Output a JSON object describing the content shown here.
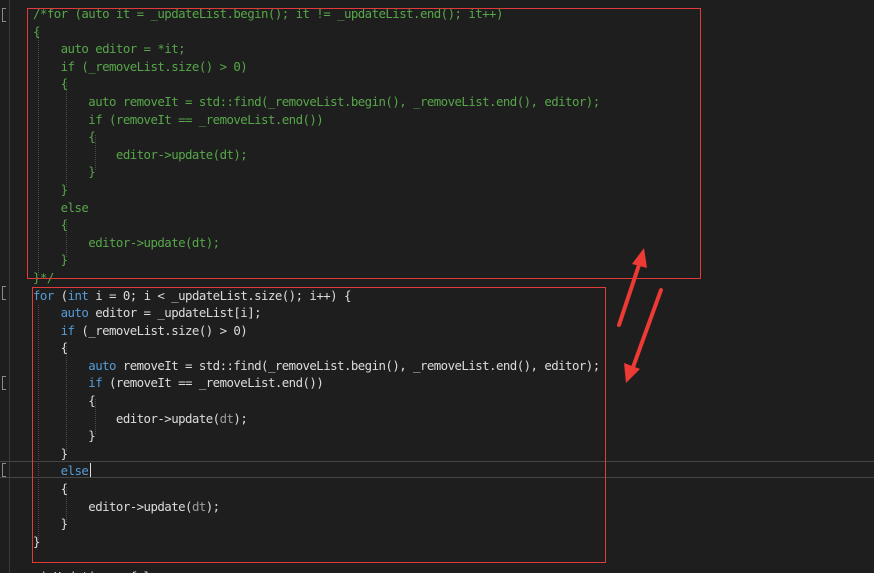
{
  "editor": {
    "lines": [
      {
        "indent": "",
        "tokens": [
          {
            "t": "/*for (auto it = _updateList.begin(); it != _updateList.end(); it++)",
            "c": "c"
          }
        ]
      },
      {
        "indent": "",
        "tokens": [
          {
            "t": "{",
            "c": "c"
          }
        ]
      },
      {
        "indent": "    ",
        "tokens": [
          {
            "t": "auto editor = *it;",
            "c": "c"
          }
        ]
      },
      {
        "indent": "    ",
        "tokens": [
          {
            "t": "if (_removeList.size() > 0)",
            "c": "c"
          }
        ]
      },
      {
        "indent": "    ",
        "tokens": [
          {
            "t": "{",
            "c": "c"
          }
        ]
      },
      {
        "indent": "        ",
        "tokens": [
          {
            "t": "auto removeIt = std::find(_removeList.begin(), _removeList.end(), editor);",
            "c": "c"
          }
        ]
      },
      {
        "indent": "        ",
        "tokens": [
          {
            "t": "if (removeIt == _removeList.end())",
            "c": "c"
          }
        ]
      },
      {
        "indent": "        ",
        "tokens": [
          {
            "t": "{",
            "c": "c"
          }
        ]
      },
      {
        "indent": "            ",
        "tokens": [
          {
            "t": "editor->update(dt);",
            "c": "c"
          }
        ]
      },
      {
        "indent": "        ",
        "tokens": [
          {
            "t": "}",
            "c": "c"
          }
        ]
      },
      {
        "indent": "    ",
        "tokens": [
          {
            "t": "}",
            "c": "c"
          }
        ]
      },
      {
        "indent": "    ",
        "tokens": [
          {
            "t": "else",
            "c": "c"
          }
        ]
      },
      {
        "indent": "    ",
        "tokens": [
          {
            "t": "{",
            "c": "c"
          }
        ]
      },
      {
        "indent": "        ",
        "tokens": [
          {
            "t": "editor->update(dt);",
            "c": "c"
          }
        ]
      },
      {
        "indent": "    ",
        "tokens": [
          {
            "t": "}",
            "c": "c"
          }
        ]
      },
      {
        "indent": "",
        "tokens": [
          {
            "t": "}*/",
            "c": "c"
          }
        ]
      },
      {
        "indent": "",
        "tokens": [
          {
            "t": "for",
            "c": "kw"
          },
          {
            "t": " (",
            "c": "tx"
          },
          {
            "t": "int",
            "c": "kw"
          },
          {
            "t": " i = 0; i < _updateList.size(); i++) {",
            "c": "tx"
          }
        ]
      },
      {
        "indent": "    ",
        "tokens": [
          {
            "t": "auto",
            "c": "kw"
          },
          {
            "t": " editor = _updateList[i];",
            "c": "tx"
          }
        ]
      },
      {
        "indent": "    ",
        "tokens": [
          {
            "t": "if",
            "c": "kw"
          },
          {
            "t": " (_removeList.size() > 0)",
            "c": "tx"
          }
        ]
      },
      {
        "indent": "    ",
        "tokens": [
          {
            "t": "{",
            "c": "tx"
          }
        ]
      },
      {
        "indent": "        ",
        "tokens": [
          {
            "t": "auto",
            "c": "kw"
          },
          {
            "t": " removeIt = std::find(_removeList.begin(), _removeList.end(), editor);",
            "c": "tx"
          }
        ]
      },
      {
        "indent": "        ",
        "tokens": [
          {
            "t": "if",
            "c": "kw"
          },
          {
            "t": " (removeIt == _removeList.end())",
            "c": "tx"
          }
        ]
      },
      {
        "indent": "        ",
        "tokens": [
          {
            "t": "{",
            "c": "tx"
          }
        ]
      },
      {
        "indent": "            ",
        "tokens": [
          {
            "t": "editor->update(",
            "c": "tx"
          },
          {
            "t": "dt",
            "c": "dt"
          },
          {
            "t": ");",
            "c": "tx"
          }
        ]
      },
      {
        "indent": "        ",
        "tokens": [
          {
            "t": "}",
            "c": "tx"
          }
        ]
      },
      {
        "indent": "    ",
        "tokens": [
          {
            "t": "}",
            "c": "tx"
          }
        ]
      },
      {
        "indent": "    ",
        "tokens": [
          {
            "t": "else",
            "c": "kw"
          }
        ]
      },
      {
        "indent": "    ",
        "tokens": [
          {
            "t": "{",
            "c": "tx"
          }
        ]
      },
      {
        "indent": "        ",
        "tokens": [
          {
            "t": "editor->update(",
            "c": "tx"
          },
          {
            "t": "dt",
            "c": "dt"
          },
          {
            "t": ");",
            "c": "tx"
          }
        ]
      },
      {
        "indent": "    ",
        "tokens": [
          {
            "t": "}",
            "c": "tx"
          }
        ]
      },
      {
        "indent": "",
        "tokens": [
          {
            "t": "}",
            "c": "tx"
          }
        ]
      },
      {
        "indent": "",
        "tokens": [
          {
            "t": "",
            "c": "tx"
          }
        ]
      },
      {
        "indent": "",
        "tokens": [
          {
            "t": "_isUpdating = false;",
            "c": "tx"
          }
        ]
      }
    ]
  },
  "colors": {
    "background": "#1e1e1e",
    "comment": "#57a64a",
    "keyword": "#569cd6",
    "text": "#dcdcdc",
    "highlight_box": "#e03a3a",
    "arrow": "#ee3a34"
  }
}
